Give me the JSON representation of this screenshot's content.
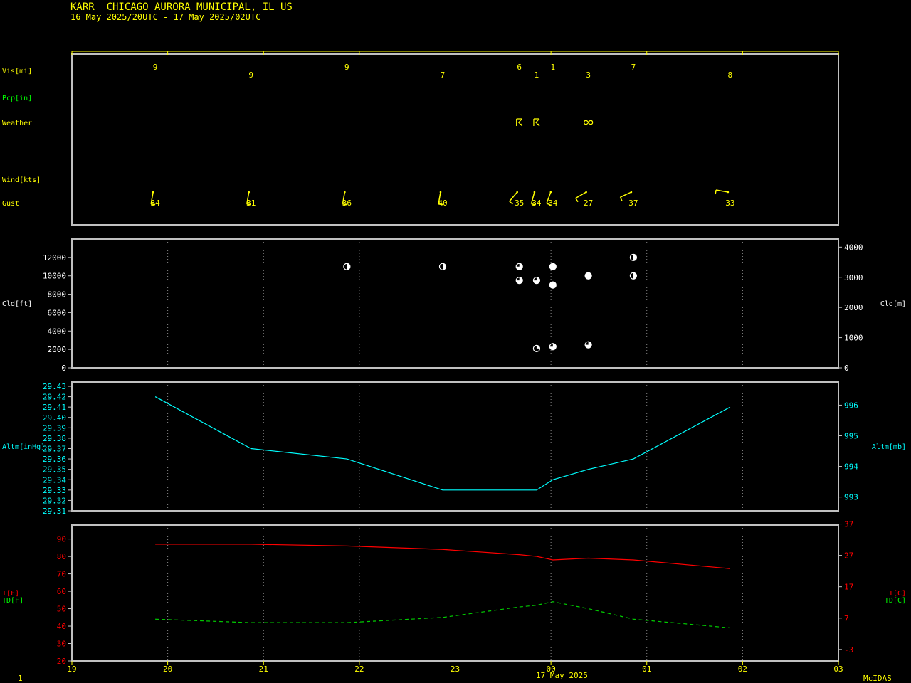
{
  "header": {
    "title": "KARR  CHICAGO AURORA MUNICIPAL, IL US",
    "subtitle": "16 May 2025/20UTC - 17 May 2025/02UTC"
  },
  "footer": {
    "left": "1",
    "right": "McIDAS",
    "date": "17 May 2025"
  },
  "colors": {
    "yellow": "#ffff00",
    "gray": "#c0c0c0",
    "white": "#ffffff",
    "green": "#00ff00",
    "cyan": "#00ffff",
    "red": "#ff0000",
    "dew": "#00cc00"
  },
  "chart_data": {
    "type": "line",
    "x_axis": {
      "ticks": [
        "19",
        "20",
        "21",
        "22",
        "23",
        "00",
        "01",
        "02",
        "03"
      ],
      "tick_hours": [
        -5,
        -4,
        -3,
        -2,
        -1,
        0,
        1,
        2,
        3
      ],
      "range_hours": [
        -5,
        3
      ],
      "date_label": "17 May 2025",
      "grid": true
    },
    "labels": {
      "vis": "Vis[mi]",
      "pcp": "Pcp[in]",
      "weather": "Weather",
      "wind": "Wind[kts]",
      "gust": "Gust",
      "cld_ft": "Cld[ft]",
      "cld_m": "Cld[m]",
      "altm_inhg": "Altm[inHg]",
      "altm_mb": "Altm[mb]",
      "t_f": "T[F]",
      "td_f": "TD[F]",
      "t_c": "T[C]",
      "td_c": "TD[C]"
    },
    "observations": [
      {
        "t": -4.13,
        "vis": "9",
        "row": 0,
        "gust": "34",
        "wind_dir": 190,
        "wind_speed": 10
      },
      {
        "t": -3.13,
        "vis": "9",
        "row": 1,
        "gust": "31",
        "wind_dir": 190,
        "wind_speed": 10
      },
      {
        "t": -2.13,
        "vis": "9",
        "row": 0,
        "gust": "36",
        "wind_dir": 190,
        "wind_speed": 10
      },
      {
        "t": -1.13,
        "vis": "7",
        "row": 1,
        "gust": "40",
        "wind_dir": 190,
        "wind_speed": 10
      },
      {
        "t": -0.33,
        "vis": "6",
        "row": 0,
        "gust": "35",
        "wind_dir": 220,
        "wind_speed": 10,
        "weather": "thunderstorm"
      },
      {
        "t": -0.15,
        "vis": "1",
        "row": 1,
        "gust": "34",
        "wind_dir": 195,
        "wind_speed": 10,
        "weather": "thunderstorm"
      },
      {
        "t": 0.02,
        "vis": "1",
        "row": 0,
        "gust": "34",
        "wind_dir": 200,
        "wind_speed": 10
      },
      {
        "t": 0.39,
        "vis": "3",
        "row": 1,
        "gust": "27",
        "wind_dir": 240,
        "wind_speed": 10,
        "weather": "haze"
      },
      {
        "t": 0.86,
        "vis": "7",
        "row": 0,
        "gust": "37",
        "wind_dir": 245,
        "wind_speed": 10
      },
      {
        "t": 1.87,
        "vis": "8",
        "row": 1,
        "gust": "33",
        "wind_dir": 280,
        "wind_speed": 10
      }
    ],
    "clouds": {
      "y_ft_ticks": [
        0,
        2000,
        4000,
        6000,
        8000,
        10000,
        12000
      ],
      "y_m_ticks": [
        0,
        1000,
        2000,
        3000,
        4000
      ],
      "ylim_ft": [
        0,
        14000
      ],
      "layers": [
        {
          "t": -2.13,
          "ft": 11000,
          "cover": "SCT"
        },
        {
          "t": -1.13,
          "ft": 11000,
          "cover": "SCT"
        },
        {
          "t": -0.33,
          "ft": 11000,
          "cover": "BKN"
        },
        {
          "t": -0.33,
          "ft": 9500,
          "cover": "BKN"
        },
        {
          "t": -0.15,
          "ft": 9500,
          "cover": "BKN"
        },
        {
          "t": -0.15,
          "ft": 2100,
          "cover": "FEW"
        },
        {
          "t": 0.02,
          "ft": 11000,
          "cover": "OVC"
        },
        {
          "t": 0.02,
          "ft": 9000,
          "cover": "OVC"
        },
        {
          "t": 0.02,
          "ft": 2300,
          "cover": "BKN"
        },
        {
          "t": 0.39,
          "ft": 10000,
          "cover": "OVC"
        },
        {
          "t": 0.39,
          "ft": 2500,
          "cover": "BKN"
        },
        {
          "t": 0.86,
          "ft": 12000,
          "cover": "SCT"
        },
        {
          "t": 0.86,
          "ft": 10000,
          "cover": "SCT"
        }
      ]
    },
    "altimeter": {
      "y_inhg_ticks": [
        "29.31",
        "29.32",
        "29.33",
        "29.34",
        "29.35",
        "29.36",
        "29.37",
        "29.38",
        "29.39",
        "29.40",
        "29.41",
        "29.42",
        "29.43"
      ],
      "y_mb_ticks": [
        993,
        994,
        995,
        996
      ],
      "ylim_inhg": [
        29.31,
        29.43
      ],
      "series": [
        {
          "t": -4.13,
          "v": 29.42
        },
        {
          "t": -3.13,
          "v": 29.37
        },
        {
          "t": -2.13,
          "v": 29.36
        },
        {
          "t": -1.13,
          "v": 29.33
        },
        {
          "t": -0.15,
          "v": 29.33
        },
        {
          "t": 0.02,
          "v": 29.34
        },
        {
          "t": 0.39,
          "v": 29.35
        },
        {
          "t": 0.86,
          "v": 29.36
        },
        {
          "t": 1.87,
          "v": 29.41
        }
      ]
    },
    "temperature": {
      "y_f_ticks": [
        20,
        30,
        40,
        50,
        60,
        70,
        80,
        90
      ],
      "y_c_ticks": [
        -3,
        7,
        17,
        27,
        37
      ],
      "ylim_f": [
        20,
        98
      ],
      "t_series": [
        {
          "t": -4.13,
          "v": 87
        },
        {
          "t": -3.13,
          "v": 87
        },
        {
          "t": -2.13,
          "v": 86
        },
        {
          "t": -1.13,
          "v": 84
        },
        {
          "t": -0.33,
          "v": 81
        },
        {
          "t": -0.15,
          "v": 80
        },
        {
          "t": 0.02,
          "v": 78
        },
        {
          "t": 0.39,
          "v": 79
        },
        {
          "t": 0.86,
          "v": 78
        },
        {
          "t": 1.87,
          "v": 73
        }
      ],
      "td_series": [
        {
          "t": -4.13,
          "v": 44
        },
        {
          "t": -3.13,
          "v": 42
        },
        {
          "t": -2.13,
          "v": 42
        },
        {
          "t": -1.13,
          "v": 45
        },
        {
          "t": -0.33,
          "v": 51
        },
        {
          "t": -0.15,
          "v": 52
        },
        {
          "t": 0.02,
          "v": 54
        },
        {
          "t": 0.39,
          "v": 50
        },
        {
          "t": 0.86,
          "v": 44
        },
        {
          "t": 1.87,
          "v": 39
        }
      ]
    }
  }
}
